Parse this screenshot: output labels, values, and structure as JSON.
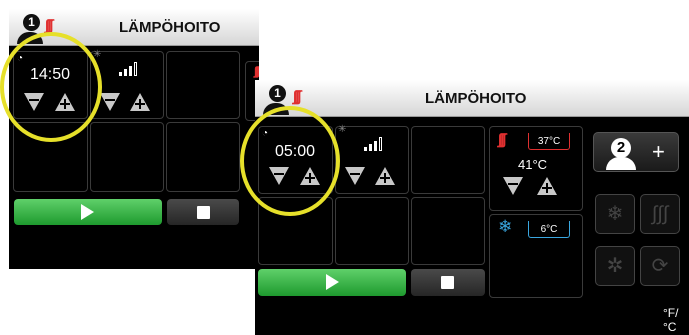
{
  "back_screen": {
    "header": {
      "title": "LÄMPÖHOITO",
      "patient_number": "1"
    },
    "timer": {
      "value": "14:50"
    },
    "play_label": "",
    "stop_label": ""
  },
  "front_screen": {
    "header": {
      "title": "LÄMPÖHOITO",
      "patient_number": "1"
    },
    "timer": {
      "value": "05:00"
    },
    "heat_panel": {
      "target": "37°C",
      "current": "41°C"
    },
    "cool_panel": {
      "target": "6°C"
    },
    "add_patient": {
      "number": "2",
      "plus": "+"
    },
    "unit_toggle": "°F/°C"
  },
  "colors": {
    "highlight_ring": "#e6e02a",
    "play": "#2fb33f",
    "heat": "#e03030",
    "cool": "#3aa7e0"
  }
}
